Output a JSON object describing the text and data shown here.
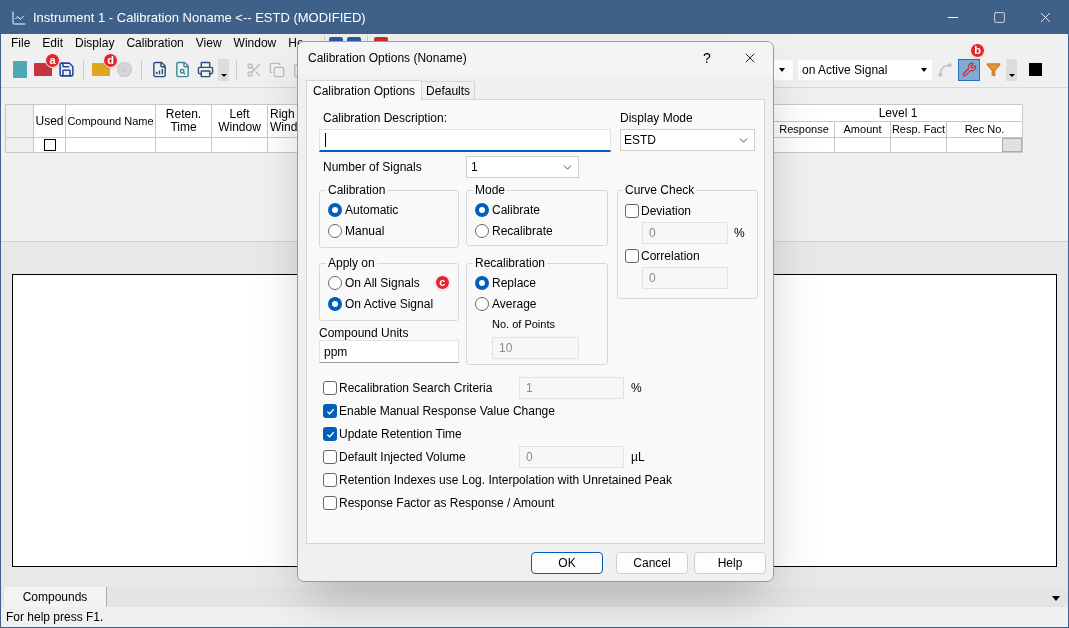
{
  "window": {
    "title": "Instrument 1 - Calibration Noname <-- ESTD (MODIFIED)"
  },
  "menu": [
    "File",
    "Edit",
    "Display",
    "Calibration",
    "View",
    "Window",
    "He"
  ],
  "toolbar": {
    "signal_combo": "on Active Signal",
    "wrench_pressed": true
  },
  "callouts": [
    {
      "label": "a"
    },
    {
      "label": "d"
    },
    {
      "label": "b"
    },
    {
      "label": "c"
    }
  ],
  "table": {
    "columns_left": [
      "Used",
      "Compound Name",
      "Reten. Time",
      "Left Window",
      "Righ Wind"
    ],
    "level_header": "Level 1",
    "columns_right": [
      "Response",
      "Amount",
      "Resp. Fact",
      "Rec No."
    ],
    "rows": [
      {
        "used": false
      }
    ]
  },
  "bottom_tabs": [
    {
      "label": "Compounds",
      "selected": true
    }
  ],
  "status_bar": "For help press F1.",
  "dialog": {
    "title": "Calibration Options (Noname)",
    "help": "?",
    "tabs": [
      {
        "label": "Calibration Options",
        "selected": true
      },
      {
        "label": "Defaults",
        "selected": false
      }
    ],
    "description": {
      "label": "Calibration Description:",
      "focused": true
    },
    "display_mode": {
      "label": "Display Mode",
      "value": "ESTD"
    },
    "signals": {
      "label": "Number of Signals",
      "value": "1"
    },
    "calibration": {
      "title": "Calibration",
      "options": [
        {
          "label": "Automatic",
          "selected": true
        },
        {
          "label": "Manual",
          "selected": false
        }
      ]
    },
    "mode": {
      "title": "Mode",
      "options": [
        {
          "label": "Calibrate",
          "selected": true
        },
        {
          "label": "Recalibrate",
          "selected": false
        }
      ]
    },
    "apply_on": {
      "title": "Apply on",
      "options": [
        {
          "label": "On All Signals",
          "selected": false
        },
        {
          "label": "On Active Signal",
          "selected": true
        }
      ]
    },
    "recalibration": {
      "title": "Recalibration",
      "options": [
        {
          "label": "Replace",
          "selected": true
        },
        {
          "label": "Average",
          "selected": false
        }
      ],
      "points_label": "No. of Points",
      "points_value": "10"
    },
    "curve_check": {
      "title": "Curve Check",
      "items": [
        {
          "label": "Deviation",
          "checked": false,
          "value": "0",
          "unit": "%"
        },
        {
          "label": "Correlation",
          "checked": false,
          "value": "0"
        }
      ]
    },
    "compound_units": {
      "label": "Compound Units",
      "value": "ppm"
    },
    "options": [
      {
        "label": "Recalibration Search Criteria",
        "checked": false,
        "value": "1",
        "unit": "%"
      },
      {
        "label": "Enable Manual Response Value Change",
        "checked": true
      },
      {
        "label": "Update Retention Time",
        "checked": true
      },
      {
        "label": "Default Injected Volume",
        "checked": false,
        "value": "0",
        "unit": "µL"
      },
      {
        "label": "Retention Indexes use Log. Interpolation with Unretained Peak",
        "checked": false
      },
      {
        "label": "Response Factor as Response / Amount",
        "checked": false
      }
    ],
    "buttons": [
      {
        "label": "OK",
        "default": true
      },
      {
        "label": "Cancel",
        "default": false
      },
      {
        "label": "Help",
        "default": false
      }
    ]
  }
}
